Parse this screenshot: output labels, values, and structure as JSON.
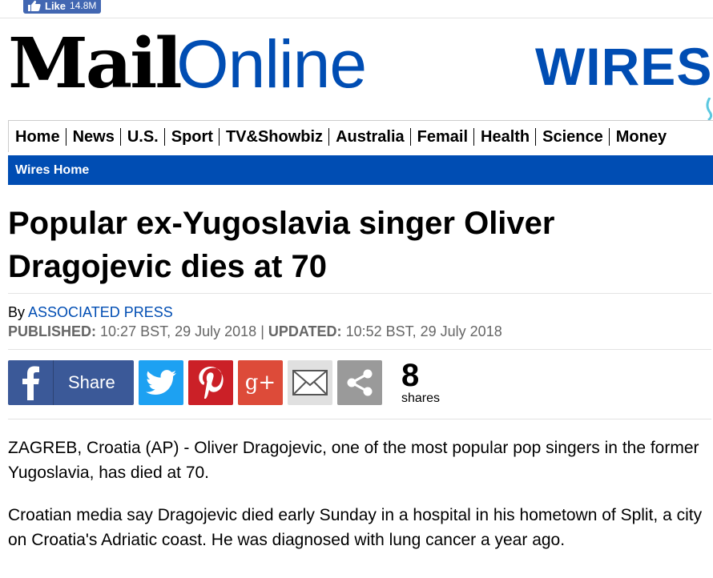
{
  "topbar": {
    "like_label": "Like",
    "like_count": "14.8M"
  },
  "masthead": {
    "logo_mail": "Mail",
    "logo_online": "Online",
    "section_banner": "WIRES"
  },
  "nav": {
    "items": [
      "Home",
      "News",
      "U.S.",
      "Sport",
      "TV&Showbiz",
      "Australia",
      "Femail",
      "Health",
      "Science",
      "Money"
    ]
  },
  "subnav": {
    "item": "Wires Home"
  },
  "article": {
    "headline": "Popular ex-Yugoslavia singer Oliver Dragojevic dies at 70",
    "by_prefix": "By",
    "author": "ASSOCIATED PRESS",
    "published_label": "PUBLISHED:",
    "published_value": "10:27 BST, 29 July 2018",
    "separator": "|",
    "updated_label": "UPDATED:",
    "updated_value": "10:52 BST, 29 July 2018",
    "paragraphs": [
      "ZAGREB, Croatia (AP) - Oliver Dragojevic, one of the most popular pop singers in the former Yugoslavia, has died at 70.",
      "Croatian media say Dragojevic died early Sunday in a hospital in his hometown of Split, a city on Croatia's Adriatic coast. He was diagnosed with lung cancer a year ago."
    ]
  },
  "share": {
    "facebook_label": "Share",
    "googleplus_label": "g+",
    "count": "8",
    "count_label": "shares",
    "colors": {
      "facebook": "#3b5998",
      "twitter": "#1da1f2",
      "pinterest": "#cb2027",
      "googleplus": "#dd4b39",
      "email": "#e0e0e0",
      "share": "#9a9a9a"
    }
  },
  "icons": [
    "thumbs-up-icon",
    "facebook-icon",
    "twitter-icon",
    "pinterest-icon",
    "google-plus-icon",
    "email-icon",
    "share-icon"
  ],
  "colors": {
    "brand_blue": "#004db3",
    "meta_gray": "#666666"
  }
}
